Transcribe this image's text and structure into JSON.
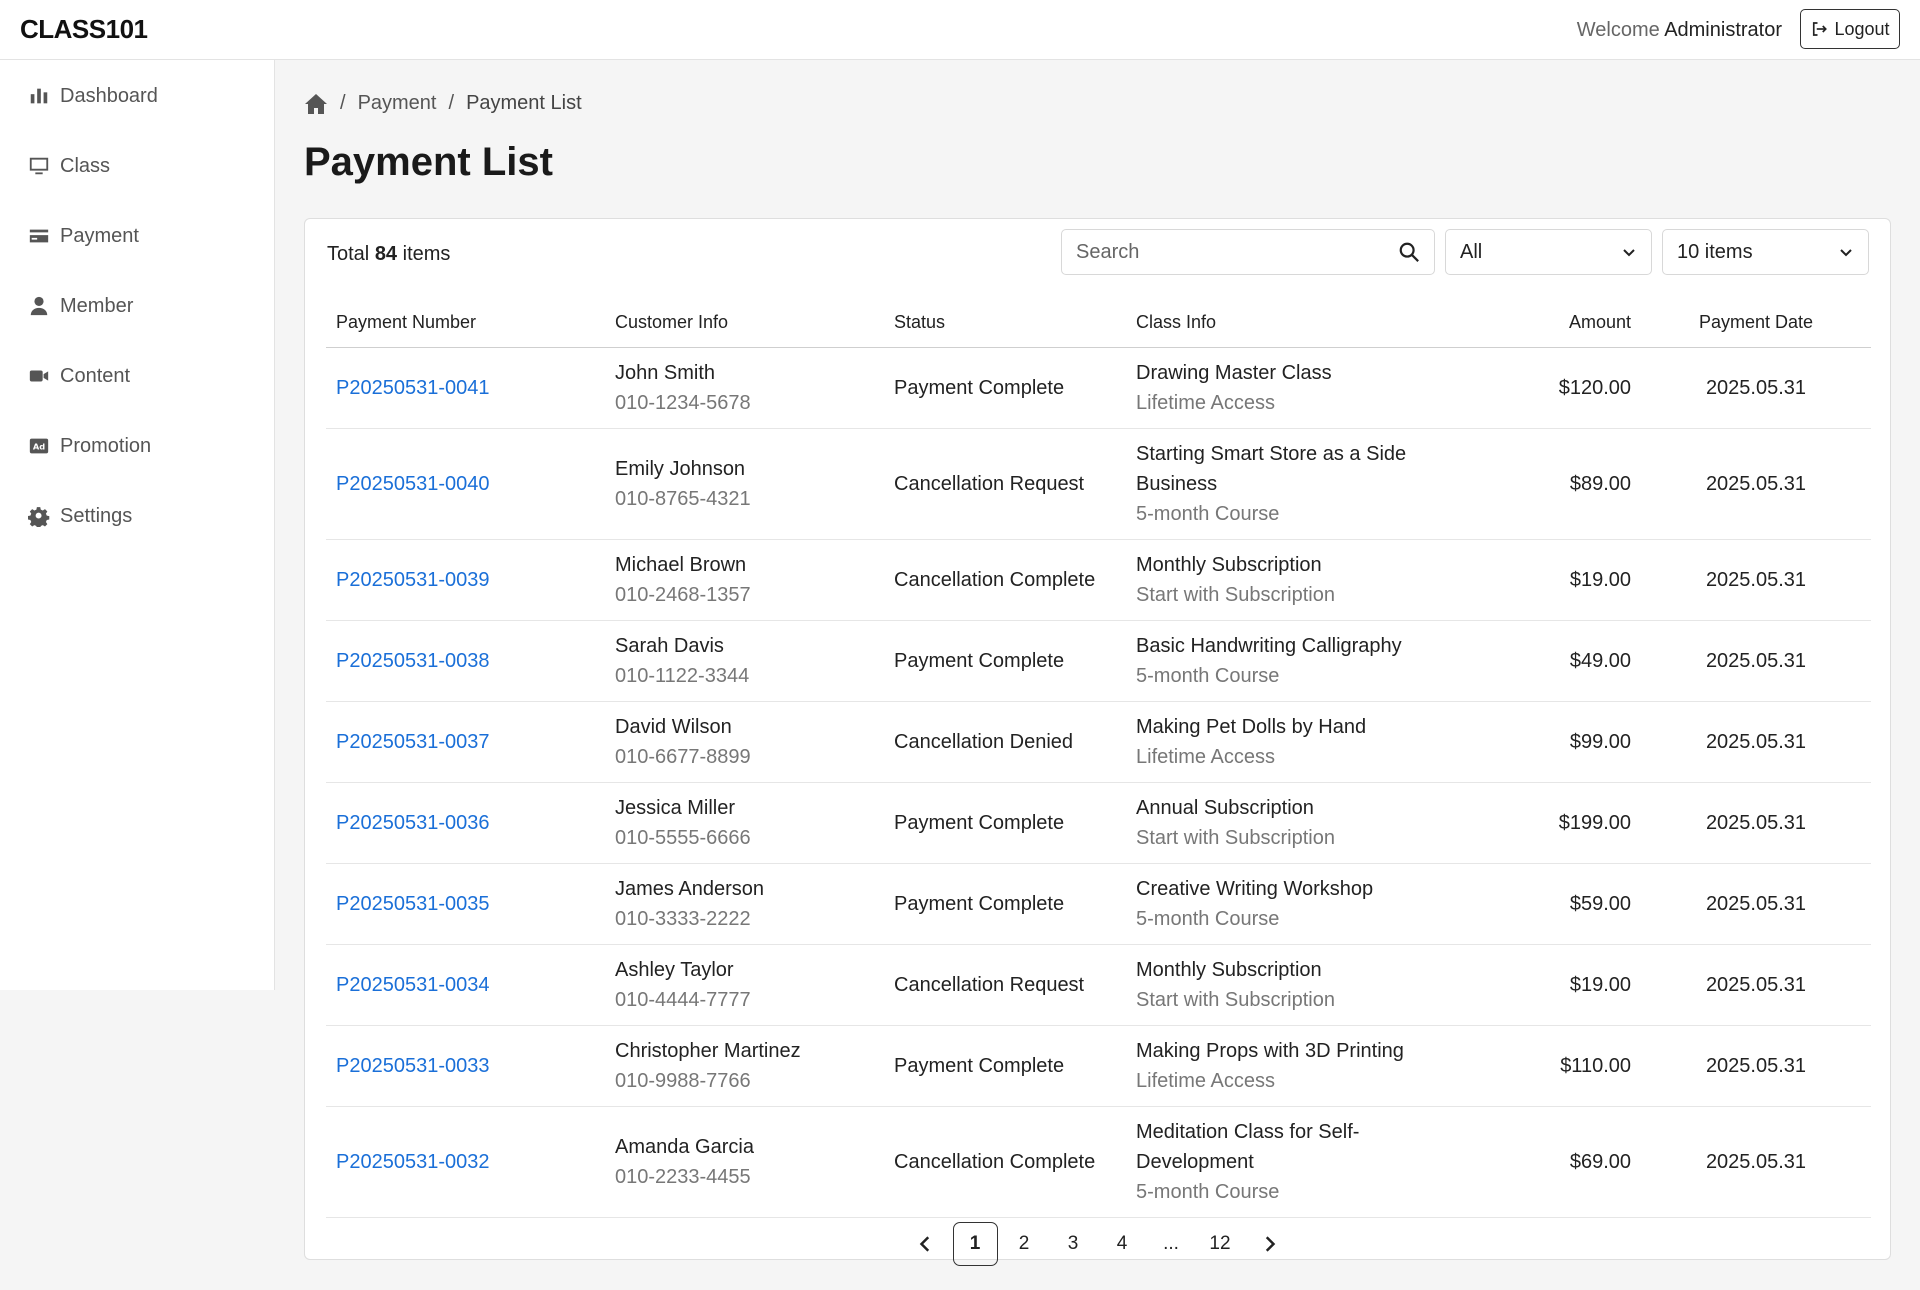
{
  "app": {
    "logo": "CLASS101"
  },
  "header": {
    "welcome_prefix": "Welcome",
    "user": "Administrator",
    "logout_label": "Logout"
  },
  "sidebar": {
    "items": [
      {
        "label": "Dashboard",
        "icon": "bar-chart-icon"
      },
      {
        "label": "Class",
        "icon": "monitor-icon"
      },
      {
        "label": "Payment",
        "icon": "credit-card-icon"
      },
      {
        "label": "Member",
        "icon": "user-icon"
      },
      {
        "label": "Content",
        "icon": "video-icon"
      },
      {
        "label": "Promotion",
        "icon": "ad-icon"
      },
      {
        "label": "Settings",
        "icon": "gear-icon"
      }
    ]
  },
  "breadcrumb": {
    "home_icon": "home-icon",
    "items": [
      "Payment",
      "Payment List"
    ],
    "separator": "/"
  },
  "page": {
    "title": "Payment List"
  },
  "toolbar": {
    "total_prefix": "Total",
    "total_count": "84",
    "total_suffix": "items",
    "search_placeholder": "Search",
    "status_filter": "All",
    "page_size": "10 items"
  },
  "table": {
    "columns": [
      "Payment Number",
      "Customer Info",
      "Status",
      "Class Info",
      "Amount",
      "Payment Date"
    ],
    "rows": [
      {
        "payment_number": "P20250531-0041",
        "customer_name": "John Smith",
        "customer_phone": "010-1234-5678",
        "status": "Payment Complete",
        "class_name": "Drawing Master Class",
        "class_type": "Lifetime Access",
        "amount": "$120.00",
        "date": "2025.05.31"
      },
      {
        "payment_number": "P20250531-0040",
        "customer_name": "Emily Johnson",
        "customer_phone": "010-8765-4321",
        "status": "Cancellation Request",
        "class_name": "Starting Smart Store as a Side Business",
        "class_type": "5-month Course",
        "amount": "$89.00",
        "date": "2025.05.31"
      },
      {
        "payment_number": "P20250531-0039",
        "customer_name": "Michael Brown",
        "customer_phone": "010-2468-1357",
        "status": "Cancellation Complete",
        "class_name": "Monthly Subscription",
        "class_type": "Start with Subscription",
        "amount": "$19.00",
        "date": "2025.05.31"
      },
      {
        "payment_number": "P20250531-0038",
        "customer_name": "Sarah Davis",
        "customer_phone": "010-1122-3344",
        "status": "Payment Complete",
        "class_name": "Basic Handwriting Calligraphy",
        "class_type": "5-month Course",
        "amount": "$49.00",
        "date": "2025.05.31"
      },
      {
        "payment_number": "P20250531-0037",
        "customer_name": "David Wilson",
        "customer_phone": "010-6677-8899",
        "status": "Cancellation Denied",
        "class_name": "Making Pet Dolls by Hand",
        "class_type": "Lifetime Access",
        "amount": "$99.00",
        "date": "2025.05.31"
      },
      {
        "payment_number": "P20250531-0036",
        "customer_name": "Jessica Miller",
        "customer_phone": "010-5555-6666",
        "status": "Payment Complete",
        "class_name": "Annual Subscription",
        "class_type": "Start with Subscription",
        "amount": "$199.00",
        "date": "2025.05.31"
      },
      {
        "payment_number": "P20250531-0035",
        "customer_name": "James Anderson",
        "customer_phone": "010-3333-2222",
        "status": "Payment Complete",
        "class_name": "Creative Writing Workshop",
        "class_type": "5-month Course",
        "amount": "$59.00",
        "date": "2025.05.31"
      },
      {
        "payment_number": "P20250531-0034",
        "customer_name": "Ashley Taylor",
        "customer_phone": "010-4444-7777",
        "status": "Cancellation Request",
        "class_name": "Monthly Subscription",
        "class_type": "Start with Subscription",
        "amount": "$19.00",
        "date": "2025.05.31"
      },
      {
        "payment_number": "P20250531-0033",
        "customer_name": "Christopher Martinez",
        "customer_phone": "010-9988-7766",
        "status": "Payment Complete",
        "class_name": "Making Props with 3D Printing",
        "class_type": "Lifetime Access",
        "amount": "$110.00",
        "date": "2025.05.31"
      },
      {
        "payment_number": "P20250531-0032",
        "customer_name": "Amanda Garcia",
        "customer_phone": "010-2233-4455",
        "status": "Cancellation Complete",
        "class_name": "Meditation Class for Self-Development",
        "class_type": "5-month Course",
        "amount": "$69.00",
        "date": "2025.05.31"
      }
    ]
  },
  "pagination": {
    "pages": [
      "1",
      "2",
      "3",
      "4",
      "...",
      "12"
    ],
    "current": "1"
  },
  "colors": {
    "link": "#1a6fd8",
    "muted": "#777777",
    "border": "#dedede",
    "background": "#f5f5f5"
  }
}
